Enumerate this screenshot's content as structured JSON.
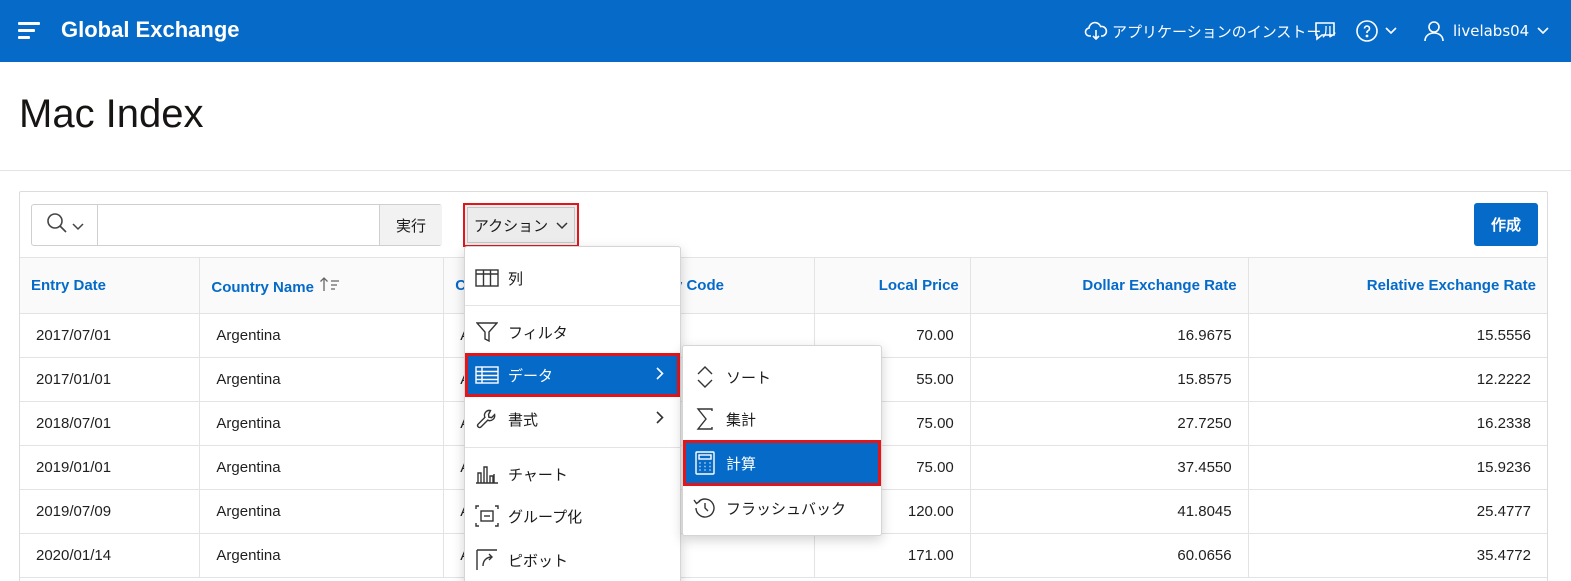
{
  "header": {
    "app_title": "Global Exchange",
    "install_label": "アプリケーションのインストール",
    "user_name": "livelabs04"
  },
  "page": {
    "title": "Mac Index"
  },
  "toolbar": {
    "go_label": "実行",
    "actions_label": "アクション",
    "create_label": "作成",
    "search_value": ""
  },
  "table": {
    "columns": [
      "Entry Date",
      "Country Name",
      "C",
      "y Code",
      "Local Price",
      "Dollar Exchange Rate",
      "Relative Exchange Rate"
    ],
    "rows": [
      [
        "2017/07/01",
        "Argentina",
        "A",
        "",
        "70.00",
        "16.9675",
        "15.5556"
      ],
      [
        "2017/01/01",
        "Argentina",
        "A",
        "",
        "55.00",
        "15.8575",
        "12.2222"
      ],
      [
        "2018/07/01",
        "Argentina",
        "A",
        "",
        "75.00",
        "27.7250",
        "16.2338"
      ],
      [
        "2019/01/01",
        "Argentina",
        "A",
        "",
        "75.00",
        "37.4550",
        "15.9236"
      ],
      [
        "2019/07/09",
        "Argentina",
        "A",
        "",
        "120.00",
        "41.8045",
        "25.4777"
      ],
      [
        "2020/01/14",
        "Argentina",
        "A",
        "",
        "171.00",
        "60.0656",
        "35.4772"
      ]
    ]
  },
  "actions_menu": {
    "items": [
      {
        "label": "列",
        "icon": "columns-icon"
      },
      {
        "label": "フィルタ",
        "icon": "filter-icon"
      },
      {
        "label": "データ",
        "icon": "data-table-icon"
      },
      {
        "label": "書式",
        "icon": "wrench-icon"
      },
      {
        "label": "チャート",
        "icon": "bar-chart-icon"
      },
      {
        "label": "グループ化",
        "icon": "group-icon"
      },
      {
        "label": "ピボット",
        "icon": "pivot-icon"
      }
    ]
  },
  "data_submenu": {
    "items": [
      {
        "label": "ソート",
        "icon": "sort-icon"
      },
      {
        "label": "集計",
        "icon": "sigma-icon"
      },
      {
        "label": "計算",
        "icon": "calculator-icon"
      },
      {
        "label": "フラッシュバック",
        "icon": "history-icon"
      }
    ]
  },
  "colors": {
    "brand": "#056ac8",
    "highlight_border": "#e0161b"
  }
}
